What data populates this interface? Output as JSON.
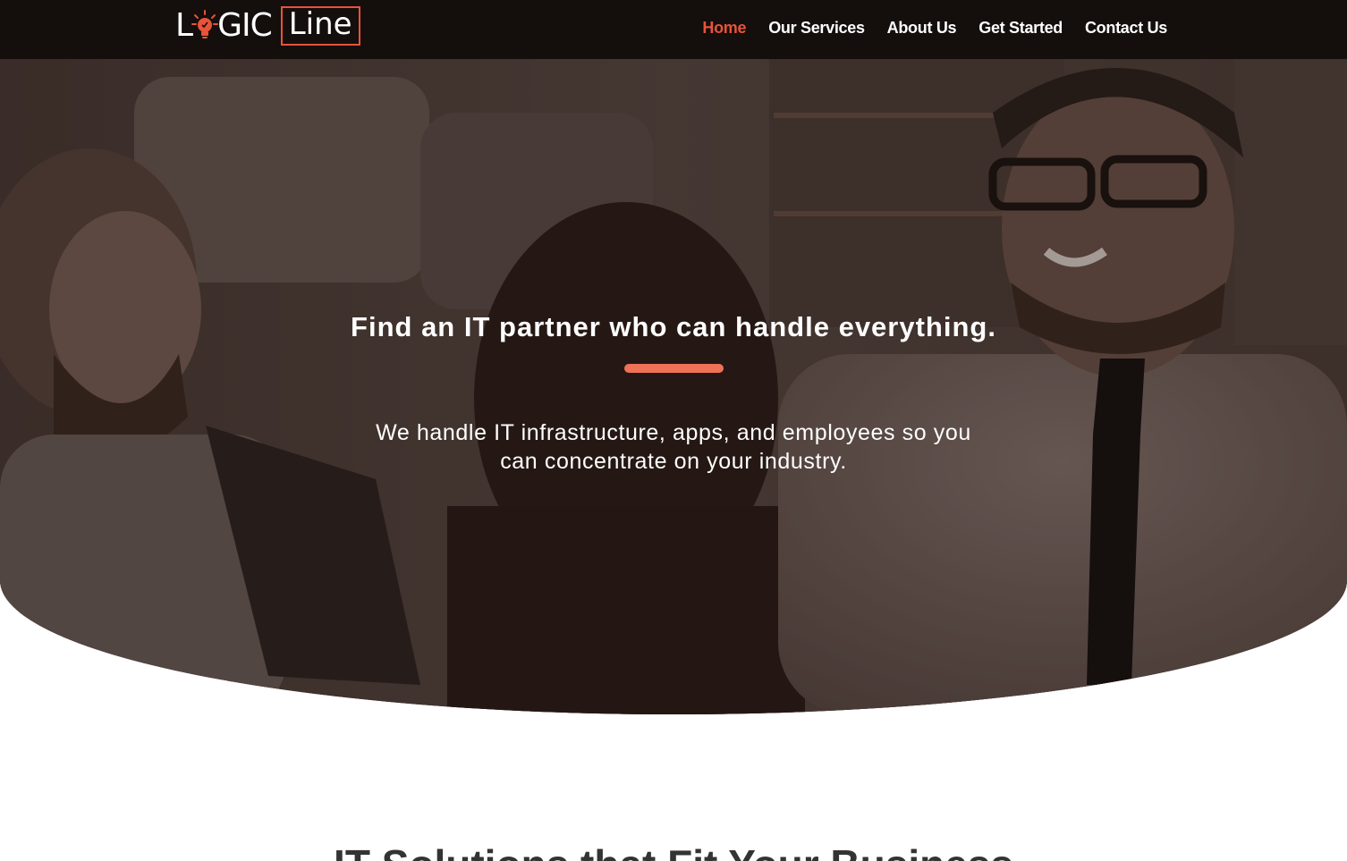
{
  "header": {
    "logo": {
      "word": "LOGIC",
      "boxed_word": "Line",
      "icon": "lightbulb-icon"
    },
    "nav": [
      {
        "label": "Home",
        "active": true
      },
      {
        "label": "Our Services",
        "active": false
      },
      {
        "label": "About Us",
        "active": false
      },
      {
        "label": "Get Started",
        "active": false
      },
      {
        "label": "Contact Us",
        "active": false
      }
    ]
  },
  "hero": {
    "title": "Find an IT partner who can handle everything.",
    "subtitle": "We handle IT infrastructure, apps, and employees so you can concentrate on your industry.",
    "background": "office-meeting-photo"
  },
  "section": {
    "heading": "IT Solutions that Fit Your Business"
  },
  "colors": {
    "accent": "#e8533a",
    "divider": "#ef7256",
    "header_bg": "#140e0c"
  }
}
